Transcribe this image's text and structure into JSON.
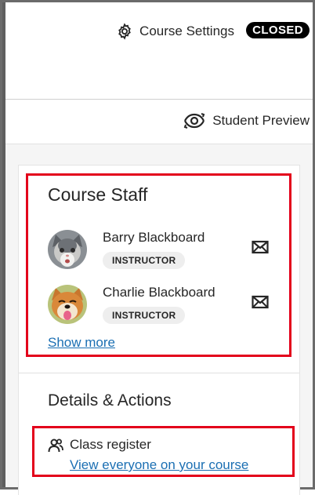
{
  "header": {
    "course_settings_label": "Course Settings",
    "status_badge": "CLOSED"
  },
  "preview": {
    "label": "Student Preview"
  },
  "course_staff": {
    "title": "Course Staff",
    "members": [
      {
        "name": "Barry Blackboard",
        "role": "INSTRUCTOR",
        "avatar": "gray-cat-photo"
      },
      {
        "name": "Charlie Blackboard",
        "role": "INSTRUCTOR",
        "avatar": "shiba-dog-photo"
      }
    ],
    "show_more_label": "Show more"
  },
  "details": {
    "title": "Details & Actions",
    "class_register": {
      "label": "Class register",
      "link": "View everyone on your course"
    }
  },
  "icons": {
    "settings": "gear-icon",
    "preview": "eye-refresh-icon",
    "message": "envelope-icon",
    "register": "people-icon"
  },
  "colors": {
    "link": "#1b6fb3",
    "badge_bg": "#000000",
    "highlight": "#e3001b"
  }
}
